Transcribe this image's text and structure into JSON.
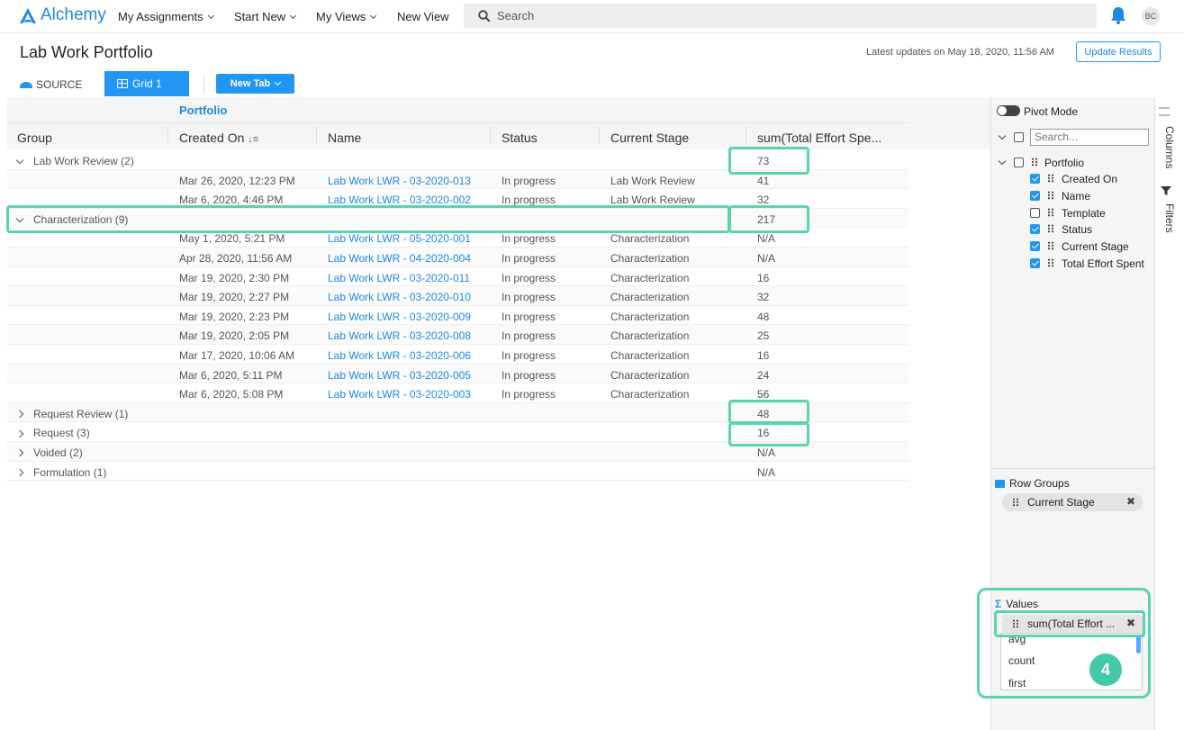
{
  "nav": {
    "logo": "Alchemy",
    "items": [
      "My Assignments",
      "Start New",
      "My Views",
      "New View"
    ],
    "search_placeholder": "Search",
    "avatar": "BC"
  },
  "page": {
    "title": "Lab Work Portfolio",
    "latest_updates": "Latest updates on May 18, 2020, 11:56 AM",
    "update_button": "Update Results"
  },
  "tabs": {
    "source": "SOURCE",
    "grid": "Grid 1",
    "new_tab": "New Tab"
  },
  "grid": {
    "group_header": "Portfolio",
    "columns": [
      "Group",
      "Created On",
      "Name",
      "Status",
      "Current Stage",
      "sum(Total Effort Spe..."
    ],
    "rows": [
      {
        "type": "group",
        "expanded": true,
        "group": "Lab Work Review (2)",
        "sum": "73"
      },
      {
        "type": "leaf",
        "created": "Mar 26, 2020, 12:23 PM",
        "name": "Lab Work LWR - 03-2020-013",
        "status": "In progress",
        "stage": "Lab Work Review",
        "sum": "41"
      },
      {
        "type": "leaf",
        "created": "Mar 6, 2020, 4:46 PM",
        "name": "Lab Work LWR - 03-2020-002",
        "status": "In progress",
        "stage": "Lab Work Review",
        "sum": "32"
      },
      {
        "type": "group",
        "expanded": true,
        "group": "Characterization (9)",
        "sum": "217"
      },
      {
        "type": "leaf",
        "created": "May 1, 2020, 5:21 PM",
        "name": "Lab Work LWR - 05-2020-001",
        "status": "In progress",
        "stage": "Characterization",
        "sum": "N/A"
      },
      {
        "type": "leaf",
        "created": "Apr 28, 2020, 11:56 AM",
        "name": "Lab Work LWR - 04-2020-004",
        "status": "In progress",
        "stage": "Characterization",
        "sum": "N/A"
      },
      {
        "type": "leaf",
        "created": "Mar 19, 2020, 2:30 PM",
        "name": "Lab Work LWR - 03-2020-011",
        "status": "In progress",
        "stage": "Characterization",
        "sum": "16"
      },
      {
        "type": "leaf",
        "created": "Mar 19, 2020, 2:27 PM",
        "name": "Lab Work LWR - 03-2020-010",
        "status": "In progress",
        "stage": "Characterization",
        "sum": "32"
      },
      {
        "type": "leaf",
        "created": "Mar 19, 2020, 2:23 PM",
        "name": "Lab Work LWR - 03-2020-009",
        "status": "In progress",
        "stage": "Characterization",
        "sum": "48"
      },
      {
        "type": "leaf",
        "created": "Mar 19, 2020, 2:05 PM",
        "name": "Lab Work LWR - 03-2020-008",
        "status": "In progress",
        "stage": "Characterization",
        "sum": "25"
      },
      {
        "type": "leaf",
        "created": "Mar 17, 2020, 10:06 AM",
        "name": "Lab Work LWR - 03-2020-006",
        "status": "In progress",
        "stage": "Characterization",
        "sum": "16"
      },
      {
        "type": "leaf",
        "created": "Mar 6, 2020, 5:11 PM",
        "name": "Lab Work LWR - 03-2020-005",
        "status": "In progress",
        "stage": "Characterization",
        "sum": "24"
      },
      {
        "type": "leaf",
        "created": "Mar 6, 2020, 5:08 PM",
        "name": "Lab Work LWR - 03-2020-003",
        "status": "In progress",
        "stage": "Characterization",
        "sum": "56"
      },
      {
        "type": "group",
        "expanded": false,
        "group": "Request Review (1)",
        "sum": "48"
      },
      {
        "type": "group",
        "expanded": false,
        "group": "Request (3)",
        "sum": "16"
      },
      {
        "type": "group",
        "expanded": false,
        "group": "Voided (2)",
        "sum": "N/A"
      },
      {
        "type": "group",
        "expanded": false,
        "group": "Formulation (1)",
        "sum": "N/A"
      }
    ]
  },
  "panel": {
    "pivot_mode": "Pivot Mode",
    "search_placeholder": "Search...",
    "portfolio": "Portfolio",
    "columns": [
      {
        "label": "Created On",
        "checked": true
      },
      {
        "label": "Name",
        "checked": true
      },
      {
        "label": "Template",
        "checked": false
      },
      {
        "label": "Status",
        "checked": true
      },
      {
        "label": "Current Stage",
        "checked": true
      },
      {
        "label": "Total Effort Spent",
        "checked": true
      }
    ],
    "row_groups_label": "Row Groups",
    "row_group_pill": "Current Stage",
    "values_label": "Values",
    "values_pill": "sum(Total Effort ...",
    "agg_options": [
      "avg",
      "count",
      "first"
    ],
    "side_tabs": {
      "columns": "Columns",
      "filters": "Filters"
    },
    "step_badge": "4"
  },
  "colors": {
    "accent": "#2196f3",
    "highlight": "#5ad3b3",
    "badge": "#42c9a8"
  }
}
